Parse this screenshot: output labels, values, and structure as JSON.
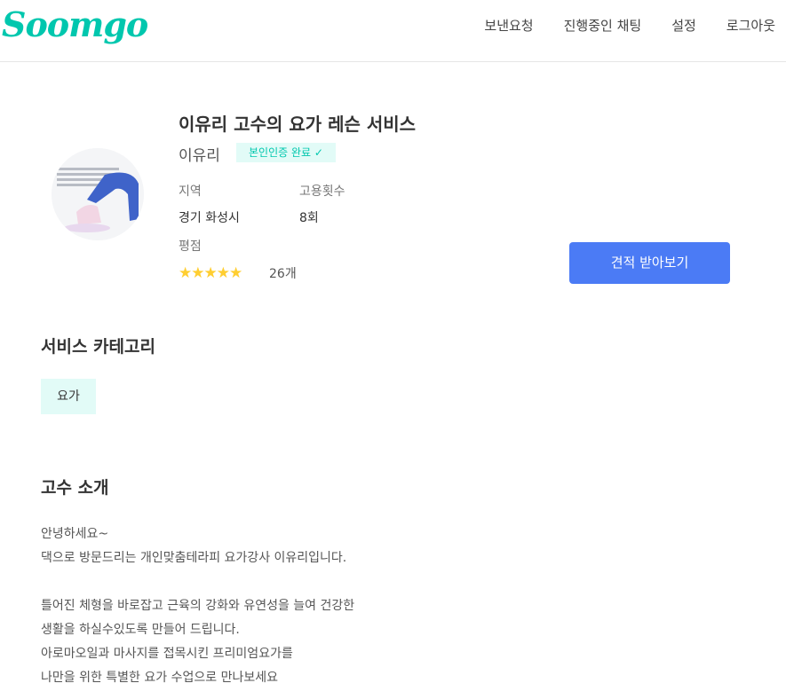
{
  "header": {
    "logo": "Soomgo",
    "nav": [
      "보낸요청",
      "진행중인 채팅",
      "설정",
      "로그아웃"
    ]
  },
  "profile": {
    "title": "이유리 고수의 요가 레슨 서비스",
    "name": "이유리",
    "verified_badge": "본인인증 완료 ✓",
    "region_label": "지역",
    "region_value": "경기 화성시",
    "hire_label": "고용횟수",
    "hire_value": "8회",
    "rating_label": "평점",
    "rating_stars": 5,
    "rating_stars_text": "★★★★★",
    "review_count": "26개",
    "quote_button": "견적 받아보기"
  },
  "categories": {
    "title": "서비스 카테고리",
    "items": [
      "요가"
    ]
  },
  "intro": {
    "title": "고수 소개",
    "lines": [
      "안녕하세요~",
      "댁으로 방문드리는 개인맞춤테라피 요가강사 이유리입니다.",
      "",
      "틀어진 체형을 바로잡고 근육의 강화와 유연성을 늘여 건강한",
      "생활을 하실수있도록 만들어 드립니다.",
      "아로마오일과 마사지를 접목시킨 프리미엄요가를",
      "나만을 위한 특별한 요가 수업으로 만나보세요"
    ]
  },
  "colors": {
    "brand": "#00c7ae",
    "accent_button": "#4b7bf5",
    "star": "#ffce31",
    "chip_bg": "#e2fbf7"
  }
}
